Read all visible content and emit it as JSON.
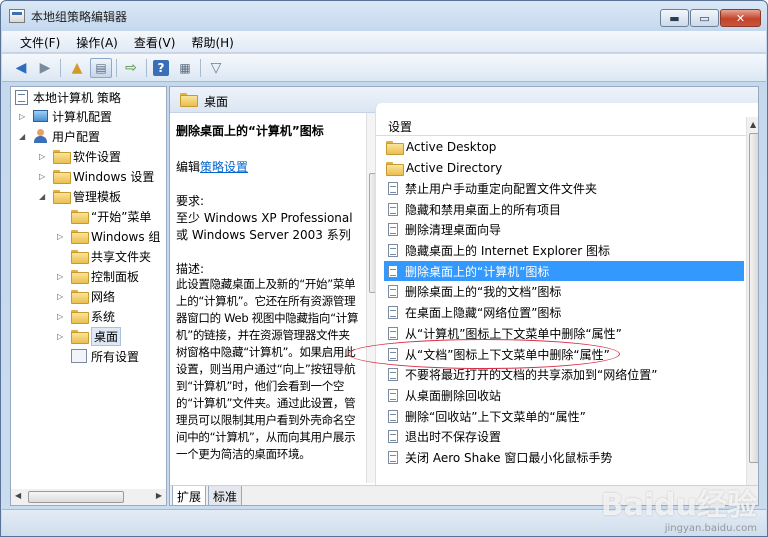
{
  "window": {
    "title": "本地组策略编辑器",
    "min": "▬",
    "max": "▭",
    "close": "✕"
  },
  "menu": [
    "文件(F)",
    "操作(A)",
    "查看(V)",
    "帮助(H)"
  ],
  "tree": {
    "root": "本地计算机 策略",
    "computer_config": "计算机配置",
    "user_config": "用户配置",
    "software": "软件设置",
    "windows_settings": "Windows 设置",
    "admin_templates": "管理模板",
    "start_menu": "“开始”菜单",
    "windows_components": "Windows 组",
    "shared_folders": "共享文件夹",
    "control_panel": "控制面板",
    "network": "网络",
    "system": "系统",
    "desktop": "桌面",
    "all_settings": "所有设置"
  },
  "header": {
    "title": "桌面"
  },
  "description": {
    "title": "删除桌面上的“计算机”图标",
    "edit_prefix": "编辑",
    "edit_link": "策略设置",
    "requirements_label": "要求:",
    "requirements_line1": "至少 Windows XP Professional",
    "requirements_line2": "或 Windows Server 2003 系列",
    "description_label": "描述:",
    "body": "此设置隐藏桌面上及新的“开始”菜单上的“计算机”。它还在所有资源管理器窗口的 Web 视图中隐藏指向“计算机”的链接，并在资源管理器文件夹树窗格中隐藏“计算机”。如果启用此设置，则当用户通过“向上”按钮导航到“计算机”时，他们会看到一个空的“计算机”文件夹。通过此设置，管理员可以限制其用户看到外壳命名空间中的“计算机”，从而向其用户展示一个更为简洁的桌面环境。"
  },
  "list": {
    "column_header": "设置",
    "items": [
      {
        "label": "Active Desktop",
        "type": "folder"
      },
      {
        "label": "Active Directory",
        "type": "folder"
      },
      {
        "label": "禁止用户手动重定向配置文件文件夹",
        "type": "setting"
      },
      {
        "label": "隐藏和禁用桌面上的所有项目",
        "type": "setting"
      },
      {
        "label": "删除清理桌面向导",
        "type": "setting"
      },
      {
        "label": "隐藏桌面上的 Internet Explorer 图标",
        "type": "setting"
      },
      {
        "label": "删除桌面上的“计算机”图标",
        "type": "setting",
        "selected": true
      },
      {
        "label": "删除桌面上的“我的文档”图标",
        "type": "setting"
      },
      {
        "label": "在桌面上隐藏“网络位置”图标",
        "type": "setting"
      },
      {
        "label": "从“计算机”图标上下文菜单中删除“属性”",
        "type": "setting"
      },
      {
        "label": "从“文档”图标上下文菜单中删除“属性”",
        "type": "setting"
      },
      {
        "label": "不要将最近打开的文档的共享添加到“网络位置”",
        "type": "setting"
      },
      {
        "label": "从桌面删除回收站",
        "type": "setting"
      },
      {
        "label": "删除“回收站”上下文菜单的“属性”",
        "type": "setting"
      },
      {
        "label": "退出时不保存设置",
        "type": "setting"
      },
      {
        "label": "关闭 Aero Shake 窗口最小化鼠标手势",
        "type": "setting"
      }
    ]
  },
  "tabs": [
    "扩展",
    "标准"
  ],
  "watermark": {
    "main": "Bai\u0000经验",
    "text": "Baidu经验",
    "sub": "jingyan.baidu.com"
  },
  "colors": {
    "selection": "#3399ff",
    "link": "#0066cc",
    "highlight_ellipse": "#d8314a"
  }
}
